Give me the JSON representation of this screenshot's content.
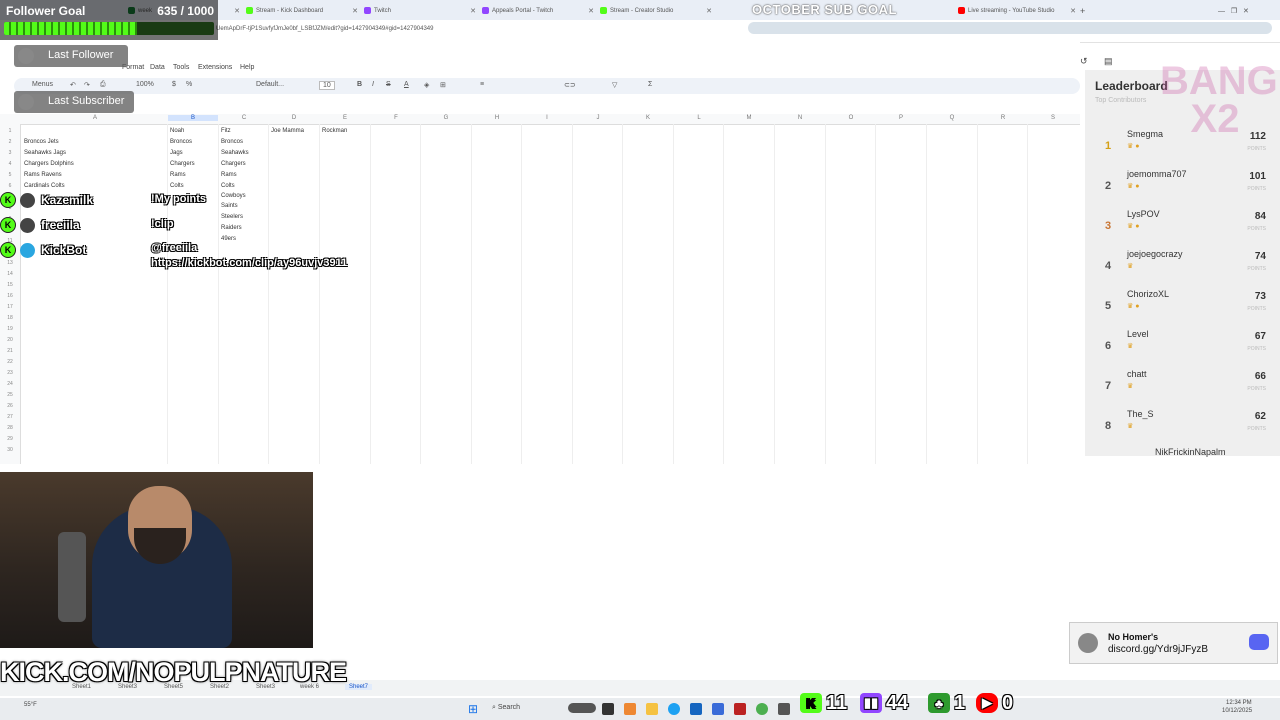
{
  "browser": {
    "tabs": [
      {
        "label": "week",
        "color": "#188038"
      },
      {
        "label": "Stream - Kick Dashboard",
        "color": "#53fc18"
      },
      {
        "label": "Twitch",
        "color": "#9146ff"
      },
      {
        "label": "Appeals Portal - Twitch",
        "color": "#9146ff"
      },
      {
        "label": "Stream - Creator Studio",
        "color": "#53fc18"
      },
      {
        "label": "Live streaming - YouTube Studio",
        "color": "#ff0000"
      }
    ],
    "url": "UemApDrF-tjP1SuvfyfJmJe0bf_LSBfJZM/edit?gid=1427904349#gid=1427904349",
    "add_tab": "+"
  },
  "sheets": {
    "menu": [
      "Format",
      "Data",
      "Tools",
      "Extensions",
      "Help"
    ],
    "toolbar": {
      "menus": "Menus",
      "zoom": "100%",
      "font": "Default...",
      "font_size": "10",
      "bold": "B",
      "italic": "I",
      "strike": "S",
      "underline_a": "A"
    },
    "columns": [
      "A",
      "B",
      "C",
      "D",
      "E",
      "F",
      "G",
      "H",
      "I",
      "J",
      "K",
      "L",
      "M",
      "N",
      "O",
      "P",
      "Q",
      "R",
      "S"
    ],
    "headers": {
      "b": "Noah",
      "c": "Fitz",
      "d": "Joe Mamma",
      "e": "Rockman"
    },
    "col_a": [
      "Broncos Jets",
      "Seahawks Jags",
      "Chargers Dolphins",
      "Rams Ravens",
      "Cardinals Colts"
    ],
    "col_b": [
      "Broncos",
      "Jags",
      "Chargers",
      "Rams",
      "Colts"
    ],
    "col_c": [
      "Broncos",
      "Seahawks",
      "Chargers",
      "Rams",
      "Colts",
      "Cowboys",
      "Saints",
      "Steelers",
      "Raiders",
      "49ers"
    ],
    "sheet_tabs": [
      "Sheet1",
      "Sheet3",
      "Sheet5",
      "Sheet2",
      "Sheet3",
      "week 6",
      "Sheet7"
    ]
  },
  "overlay": {
    "follower_goal": {
      "label": "Follower Goal",
      "count": "635 / 1000",
      "current": 635,
      "target": 1000
    },
    "last_follower": "Last Follower",
    "last_subscriber": "Last Subscriber",
    "sub_goal": "OCTOBER SUB GOAL",
    "chat": [
      {
        "name": "Kazemilk",
        "message": "!My points"
      },
      {
        "name": "freeiila",
        "message": "!clip"
      },
      {
        "name": "KickBot",
        "message": "@freeiila"
      }
    ],
    "chat_link": "https://kickbot.com/clip/ay96uvjv3911",
    "leaderboard": {
      "title": "Leaderboard",
      "subtitle": "Top Contributors",
      "unit": "POINTS",
      "rows": [
        {
          "rank": "1",
          "name": "Smegma",
          "points": "112"
        },
        {
          "rank": "2",
          "name": "joemomma707",
          "points": "101"
        },
        {
          "rank": "3",
          "name": "LysPOV",
          "points": "84"
        },
        {
          "rank": "4",
          "name": "joejoegocrazy",
          "points": "74"
        },
        {
          "rank": "5",
          "name": "ChorizoXL",
          "points": "73"
        },
        {
          "rank": "6",
          "name": "Level",
          "points": "67"
        },
        {
          "rank": "7",
          "name": "chatt",
          "points": "66"
        },
        {
          "rank": "8",
          "name": "The_S",
          "points": "62"
        }
      ],
      "partial_name": "NikFrickinNapalm"
    },
    "bang_text": "BANG X2",
    "channel": "KICK.COM/NOPULPNATURE",
    "discord": {
      "name": "No Homer's",
      "link": "discord.gg/Ydr9jJFyzB"
    },
    "stats": [
      {
        "platform": "kick",
        "value": "11",
        "color": "#53fc18"
      },
      {
        "platform": "twitch",
        "value": "44",
        "color": "#9146ff"
      },
      {
        "platform": "kick-followers",
        "value": "1",
        "color": "#2e9a2e"
      },
      {
        "platform": "youtube",
        "value": "0",
        "color": "#ff0000"
      }
    ]
  },
  "taskbar": {
    "weather": "55°F",
    "search": "Search",
    "time": "12:34 PM",
    "date": "10/12/2025"
  }
}
